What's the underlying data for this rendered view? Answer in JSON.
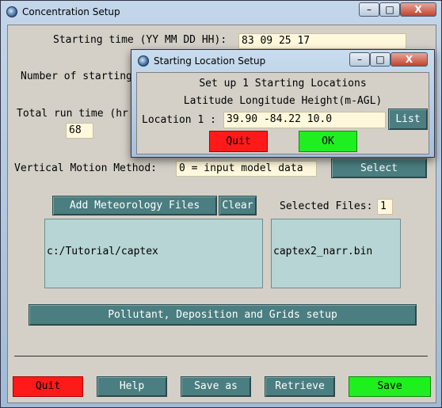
{
  "main": {
    "title": "Concentration Setup",
    "starting_time_label": "Starting time (YY MM DD HH):",
    "starting_time_value": "83 09 25 17",
    "num_start_label": "Number of starting",
    "run_time_label": "Total run time (hr",
    "run_time_value": "68",
    "vertical_label": "Vertical Motion Method:",
    "vertical_value": "0 = input model data",
    "select_btn": "Select",
    "add_met_btn": "Add Meteorology Files",
    "clear_btn": "Clear",
    "selected_files_label": "Selected Files:",
    "selected_files_count": "1",
    "dir_list": [
      "c:/Tutorial/captex"
    ],
    "file_list": [
      "captex2_narr.bin"
    ],
    "pollutant_btn": "Pollutant, Deposition and Grids setup",
    "buttons": {
      "quit": "Quit",
      "help": "Help",
      "save_as": "Save as",
      "retrieve": "Retrieve",
      "save": "Save"
    },
    "colors": {
      "quit": "#ff1a1a",
      "save": "#1fef1f",
      "button": "#4a7e80",
      "entry": "#fff8dc",
      "listbox": "#b7d5d4"
    }
  },
  "dialog": {
    "title": "Starting Location Setup",
    "header": "Set up 1 Starting Locations",
    "subheader": "Latitude Longitude Height(m-AGL)",
    "location_label": "Location 1 :",
    "location_value": "39.90 -84.22 10.0",
    "list_btn": "List",
    "quit_btn": "Quit",
    "ok_btn": "OK"
  },
  "titlebar": {
    "minimize": "–",
    "maximize": "□",
    "close": "X"
  }
}
